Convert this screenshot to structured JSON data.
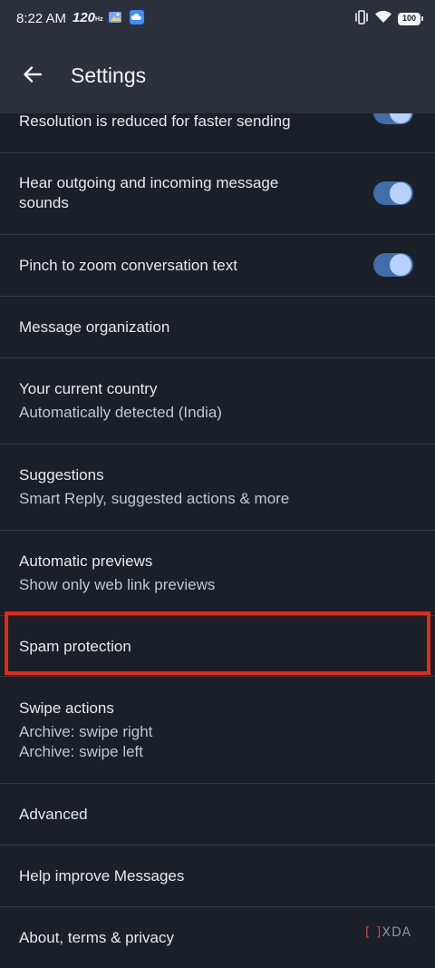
{
  "status_bar": {
    "time": "8:22 AM",
    "refresh_rate": "120",
    "refresh_unit": "Hz",
    "battery": "100",
    "icons": [
      "notification-icon",
      "cloud-icon",
      "vibrate-icon",
      "wifi-icon",
      "battery-icon"
    ]
  },
  "app_bar": {
    "title": "Settings",
    "back_icon": "arrow-left-icon"
  },
  "settings": {
    "resolution": {
      "title": "Resolution is reduced for faster sending",
      "enabled": true
    },
    "sounds": {
      "title_line1": "Hear outgoing and incoming message",
      "title_line2": "sounds",
      "enabled": true
    },
    "pinch_zoom": {
      "title": "Pinch to zoom conversation text",
      "enabled": true
    },
    "organization": {
      "title": "Message organization"
    },
    "country": {
      "title": "Your current country",
      "subtitle": "Automatically detected (India)"
    },
    "suggestions": {
      "title": "Suggestions",
      "subtitle": "Smart Reply, suggested actions & more"
    },
    "previews": {
      "title": "Automatic previews",
      "subtitle": "Show only web link previews"
    },
    "spam": {
      "title": "Spam protection"
    },
    "swipe": {
      "title": "Swipe actions",
      "subtitle_line1": "Archive: swipe right",
      "subtitle_line2": "Archive: swipe left"
    },
    "advanced": {
      "title": "Advanced"
    },
    "help": {
      "title": "Help improve Messages"
    },
    "about": {
      "title": "About, terms & privacy"
    }
  },
  "watermark": {
    "bracket": "[ ]",
    "text": "XDA"
  },
  "colors": {
    "background": "#1b1f28",
    "app_bar": "#2b303b",
    "toggle_track": "#3f6eaa",
    "toggle_knob": "#b7d1ff",
    "highlight": "#e32b14"
  }
}
